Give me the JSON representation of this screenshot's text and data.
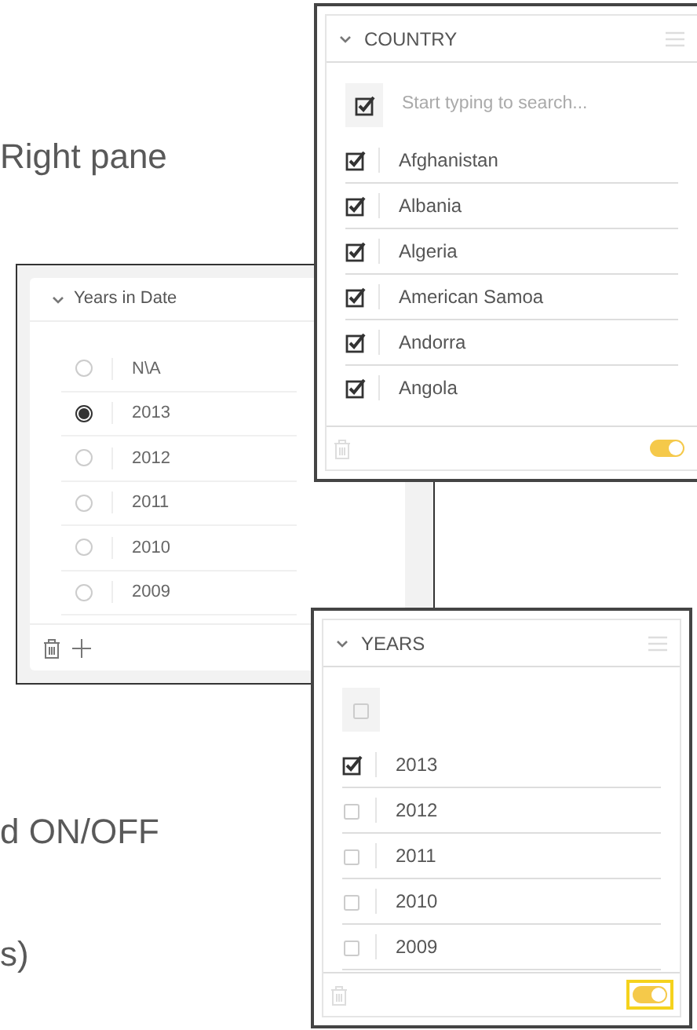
{
  "slide_text": [
    {
      "text": "Right pane"
    },
    {
      "text": "d ON/OFF"
    },
    {
      "text": "s)"
    }
  ],
  "years_in_date": {
    "title": "Years in Date",
    "options": [
      {
        "label": "N\\A",
        "selected": false
      },
      {
        "label": "2013",
        "selected": true
      },
      {
        "label": "2012",
        "selected": false
      },
      {
        "label": "2011",
        "selected": false
      },
      {
        "label": "2010",
        "selected": false
      },
      {
        "label": "2009",
        "selected": false
      }
    ]
  },
  "country": {
    "title": "COUNTRY",
    "select_all_checked": true,
    "placeholder": "Start typing to search...",
    "items": [
      {
        "label": "Afghanistan",
        "checked": true
      },
      {
        "label": "Albania",
        "checked": true
      },
      {
        "label": "Algeria",
        "checked": true
      },
      {
        "label": "American Samoa",
        "checked": true
      },
      {
        "label": "Andorra",
        "checked": true
      },
      {
        "label": "Angola",
        "checked": true
      }
    ],
    "toggle": {
      "on": true,
      "highlighted": false
    }
  },
  "years": {
    "title": "YEARS",
    "select_all_checked": false,
    "items": [
      {
        "label": "2013",
        "checked": true
      },
      {
        "label": "2012",
        "checked": false
      },
      {
        "label": "2011",
        "checked": false
      },
      {
        "label": "2010",
        "checked": false
      },
      {
        "label": "2009",
        "checked": false
      }
    ],
    "toggle": {
      "on": true,
      "highlighted": true
    }
  }
}
